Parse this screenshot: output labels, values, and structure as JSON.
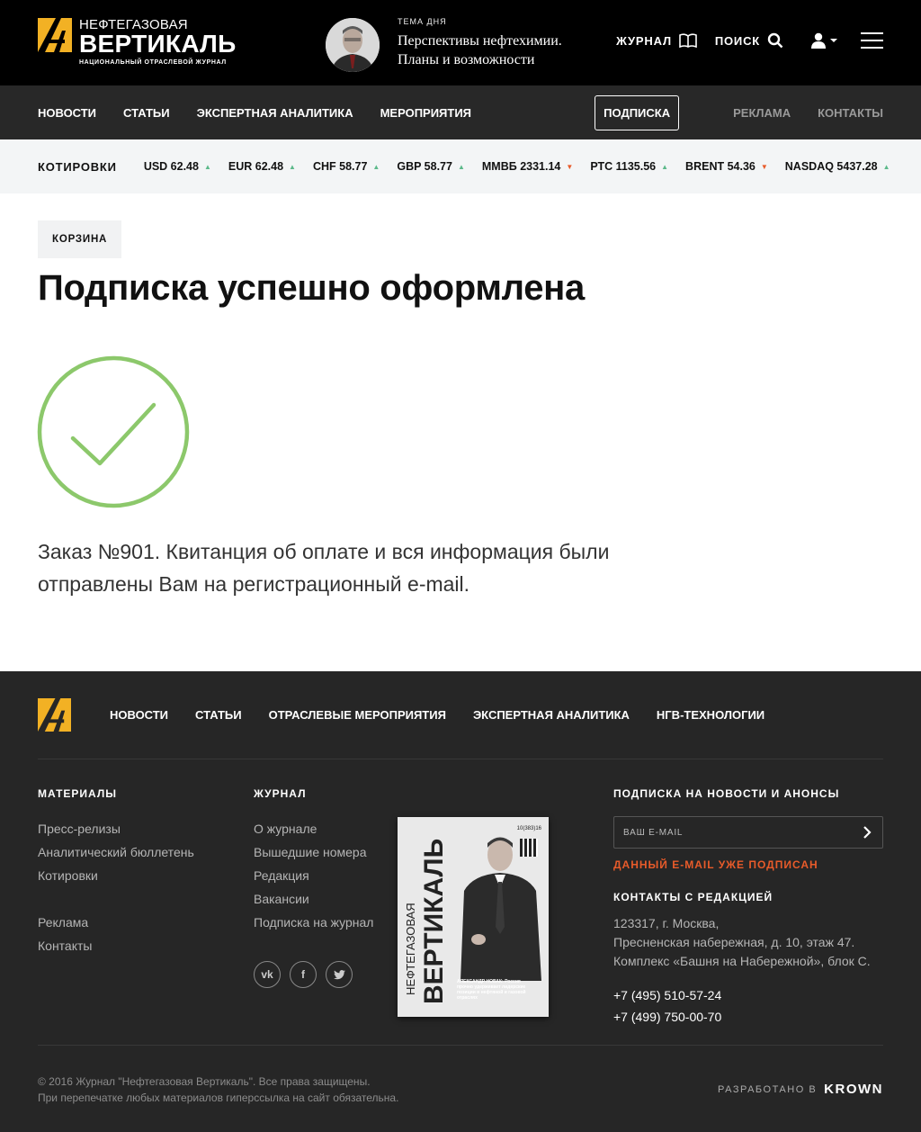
{
  "header": {
    "logo": {
      "line1": "НЕФТЕГАЗОВАЯ",
      "line2": "ВЕРТИКАЛЬ",
      "line3": "НАЦИОНАЛЬНЫЙ ОТРАСЛЕВОЙ ЖУРНАЛ"
    },
    "topic_label": "ТЕМА ДНЯ",
    "topic_line1": "Перспективы нефтехимии.",
    "topic_line2": "Планы и возможности",
    "journal_label": "ЖУРНАЛ",
    "search_label": "ПОИСК"
  },
  "nav": {
    "items": [
      "НОВОСТИ",
      "СТАТЬИ",
      "ЭКСПЕРТНАЯ АНАЛИТИКА",
      "МЕРОПРИЯТИЯ"
    ],
    "subscribe": "ПОДПИСКА",
    "ads": "РЕКЛАМА",
    "contacts": "КОНТАКТЫ"
  },
  "quotes": {
    "label": "КОТИРОВКИ",
    "items": [
      {
        "text": "USD 62.48",
        "dir": "up"
      },
      {
        "text": "EUR 62.48",
        "dir": "up"
      },
      {
        "text": "CHF 58.77",
        "dir": "up"
      },
      {
        "text": "GBP 58.77",
        "dir": "up"
      },
      {
        "text": "ММВБ 2331.14",
        "dir": "down"
      },
      {
        "text": "РТС 1135.56",
        "dir": "up"
      },
      {
        "text": "BRENT 54.36",
        "dir": "down"
      },
      {
        "text": "NASDAQ 5437.28",
        "dir": "up"
      }
    ]
  },
  "main": {
    "breadcrumb": "КОРЗИНА",
    "title": "Подписка успешно оформлена",
    "message_line1": "Заказ №901. Квитанция об оплате и вся информация были",
    "message_line2": "отправлены Вам на регистрационный e-mail.",
    "success_color": "#8cc86b"
  },
  "footer": {
    "nav": [
      "НОВОСТИ",
      "СТАТЬИ",
      "ОТРАСЛЕВЫЕ МЕРОПРИЯТИЯ",
      "ЭКСПЕРТНАЯ АНАЛИТИКА",
      "НГВ-ТЕХНОЛОГИИ"
    ],
    "materials_title": "МАТЕРИАЛЫ",
    "materials": [
      "Пресс-релизы",
      "Аналитический бюллетень",
      "Котировки"
    ],
    "materials2": [
      "Реклама",
      "Контакты"
    ],
    "journal_title": "ЖУРНАЛ",
    "journal_links": [
      "О журнале",
      "Вышедшие номера",
      "Редакция",
      "Вакансии",
      "Подписка на журнал"
    ],
    "cover": {
      "title1": "НЕФТЕГАЗОВАЯ",
      "title2": "ВЕРТИКАЛЬ",
      "issue": "10(383)16",
      "caption": "АЛЕКСАНДР НОВАК: Россия прочно удерживает лидерские позиции в нефтяной и газовой отраслях"
    },
    "subscribe_title": "ПОДПИСКА НА НОВОСТИ И АНОНСЫ",
    "email_placeholder": "ВАШ E-MAIL",
    "email_error": "ДАННЫЙ E-MAIL УЖЕ ПОДПИСАН",
    "contacts_title": "КОНТАКТЫ С РЕДАКЦИЕЙ",
    "address1": "123317, г. Москва,",
    "address2": "Пресненская набережная, д. 10, этаж 47.",
    "address3": "Комплекс «Башня на Набережной», блок С.",
    "phone1": "+7 (495) 510-57-24",
    "phone2": "+7 (499) 750-00-70",
    "copyright1": "© 2016 Журнал \"Нефтегазовая Вертикаль\". Все права защищены.",
    "copyright2": "При перепечатке любых материалов гиперссылка на сайт обязательна.",
    "dev_label": "РАЗРАБОТАНО В",
    "dev_brand": "KROWN"
  },
  "colors": {
    "accent": "#f2b124",
    "up": "#5cb98a",
    "down": "#e85b2a"
  },
  "icons": [
    "logo-icon",
    "book-icon",
    "search-icon",
    "user-icon",
    "menu-icon",
    "checkmark-icon",
    "arrow-right-icon",
    "vk-icon",
    "facebook-icon",
    "twitter-icon"
  ]
}
